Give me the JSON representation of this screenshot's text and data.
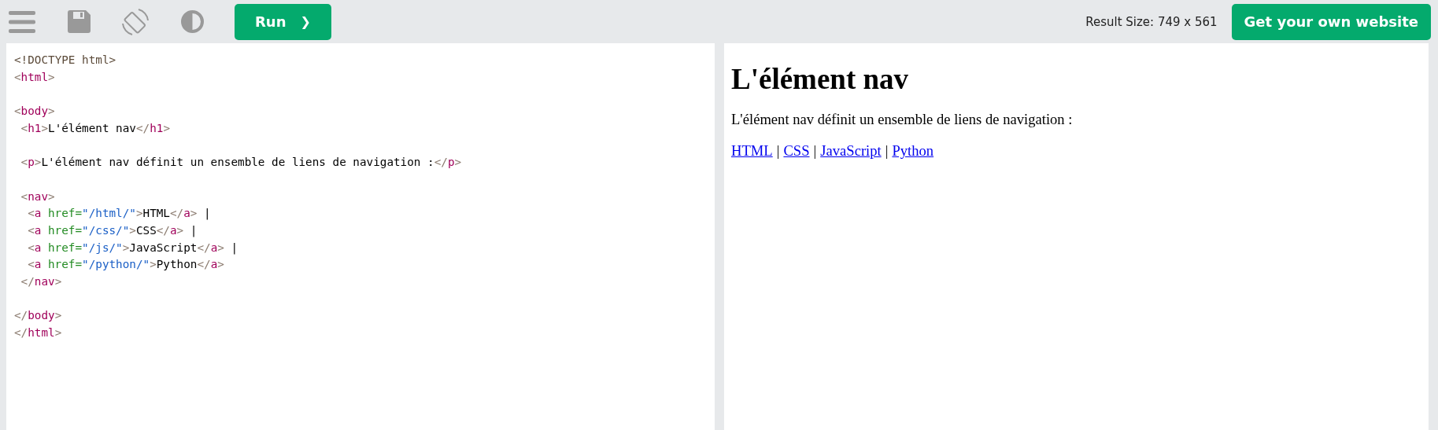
{
  "toolbar": {
    "run_button": "Run",
    "run_caret": "❯",
    "result_size": "Result Size: 749 x 561",
    "cta_button": "Get your own website"
  },
  "editor": {
    "lines": [
      {
        "kind": "code",
        "tokens": [
          {
            "kind": "doctype",
            "text": "<!DOCTYPE html>"
          }
        ]
      },
      {
        "kind": "code",
        "tokens": [
          {
            "kind": "bracket",
            "text": "<"
          },
          {
            "kind": "tag",
            "text": "html"
          },
          {
            "kind": "bracket",
            "text": ">"
          }
        ]
      },
      {
        "kind": "blank"
      },
      {
        "kind": "code",
        "tokens": [
          {
            "kind": "bracket",
            "text": "<"
          },
          {
            "kind": "tag",
            "text": "body"
          },
          {
            "kind": "bracket",
            "text": ">"
          }
        ],
        "children": [
          {
            "kind": "code",
            "tokens": [
              {
                "kind": "bracket",
                "text": "<"
              },
              {
                "kind": "tag",
                "text": "h1"
              },
              {
                "kind": "bracket",
                "text": ">"
              },
              {
                "kind": "text",
                "text": "L'élément nav"
              },
              {
                "kind": "bracket",
                "text": "</"
              },
              {
                "kind": "tag",
                "text": "h1"
              },
              {
                "kind": "bracket",
                "text": ">"
              }
            ]
          },
          {
            "kind": "blank"
          },
          {
            "kind": "code",
            "tokens": [
              {
                "kind": "bracket",
                "text": "<"
              },
              {
                "kind": "tag",
                "text": "p"
              },
              {
                "kind": "bracket",
                "text": ">"
              },
              {
                "kind": "text",
                "text": "L'élément nav définit un ensemble de liens de navigation :"
              },
              {
                "kind": "bracket",
                "text": "</"
              },
              {
                "kind": "tag",
                "text": "p"
              },
              {
                "kind": "bracket",
                "text": ">"
              }
            ]
          },
          {
            "kind": "blank"
          },
          {
            "kind": "code",
            "tokens": [
              {
                "kind": "bracket",
                "text": "<"
              },
              {
                "kind": "tag",
                "text": "nav"
              },
              {
                "kind": "bracket",
                "text": ">"
              }
            ],
            "children": [
              {
                "kind": "code",
                "tokens": [
                  {
                    "kind": "bracket",
                    "text": "<"
                  },
                  {
                    "kind": "tag",
                    "text": "a"
                  },
                  {
                    "kind": "attr",
                    "text": " href="
                  },
                  {
                    "kind": "value",
                    "text": "\"/html/\""
                  },
                  {
                    "kind": "bracket",
                    "text": ">"
                  },
                  {
                    "kind": "text",
                    "text": "HTML"
                  },
                  {
                    "kind": "bracket",
                    "text": "</"
                  },
                  {
                    "kind": "tag",
                    "text": "a"
                  },
                  {
                    "kind": "bracket",
                    "text": ">"
                  },
                  {
                    "kind": "text",
                    "text": " |"
                  }
                ]
              },
              {
                "kind": "code",
                "tokens": [
                  {
                    "kind": "bracket",
                    "text": "<"
                  },
                  {
                    "kind": "tag",
                    "text": "a"
                  },
                  {
                    "kind": "attr",
                    "text": " href="
                  },
                  {
                    "kind": "value",
                    "text": "\"/css/\""
                  },
                  {
                    "kind": "bracket",
                    "text": ">"
                  },
                  {
                    "kind": "text",
                    "text": "CSS"
                  },
                  {
                    "kind": "bracket",
                    "text": "</"
                  },
                  {
                    "kind": "tag",
                    "text": "a"
                  },
                  {
                    "kind": "bracket",
                    "text": ">"
                  },
                  {
                    "kind": "text",
                    "text": " |"
                  }
                ]
              },
              {
                "kind": "code",
                "tokens": [
                  {
                    "kind": "bracket",
                    "text": "<"
                  },
                  {
                    "kind": "tag",
                    "text": "a"
                  },
                  {
                    "kind": "attr",
                    "text": " href="
                  },
                  {
                    "kind": "value",
                    "text": "\"/js/\""
                  },
                  {
                    "kind": "bracket",
                    "text": ">"
                  },
                  {
                    "kind": "text",
                    "text": "JavaScript"
                  },
                  {
                    "kind": "bracket",
                    "text": "</"
                  },
                  {
                    "kind": "tag",
                    "text": "a"
                  },
                  {
                    "kind": "bracket",
                    "text": ">"
                  },
                  {
                    "kind": "text",
                    "text": " |"
                  }
                ]
              },
              {
                "kind": "code",
                "tokens": [
                  {
                    "kind": "bracket",
                    "text": "<"
                  },
                  {
                    "kind": "tag",
                    "text": "a"
                  },
                  {
                    "kind": "attr",
                    "text": " href="
                  },
                  {
                    "kind": "value",
                    "text": "\"/python/\""
                  },
                  {
                    "kind": "bracket",
                    "text": ">"
                  },
                  {
                    "kind": "text",
                    "text": "Python"
                  },
                  {
                    "kind": "bracket",
                    "text": "</"
                  },
                  {
                    "kind": "tag",
                    "text": "a"
                  },
                  {
                    "kind": "bracket",
                    "text": ">"
                  }
                ]
              }
            ]
          },
          {
            "kind": "code",
            "tokens": [
              {
                "kind": "bracket",
                "text": "</"
              },
              {
                "kind": "tag",
                "text": "nav"
              },
              {
                "kind": "bracket",
                "text": ">"
              }
            ]
          }
        ]
      },
      {
        "kind": "blank"
      },
      {
        "kind": "code",
        "tokens": [
          {
            "kind": "bracket",
            "text": "</"
          },
          {
            "kind": "tag",
            "text": "body"
          },
          {
            "kind": "bracket",
            "text": ">"
          }
        ]
      },
      {
        "kind": "code",
        "tokens": [
          {
            "kind": "bracket",
            "text": "</"
          },
          {
            "kind": "tag",
            "text": "html"
          },
          {
            "kind": "bracket",
            "text": ">"
          }
        ]
      }
    ]
  },
  "preview": {
    "heading": "L'élément nav",
    "paragraph": "L'élément nav définit un ensemble de liens de navigation :",
    "nav": [
      {
        "kind": "link",
        "text": "HTML"
      },
      {
        "kind": "separator",
        "text": "|"
      },
      {
        "kind": "link",
        "text": "CSS"
      },
      {
        "kind": "separator",
        "text": "|"
      },
      {
        "kind": "link",
        "text": "JavaScript"
      },
      {
        "kind": "separator",
        "text": "|"
      },
      {
        "kind": "link",
        "text": "Python"
      }
    ]
  }
}
